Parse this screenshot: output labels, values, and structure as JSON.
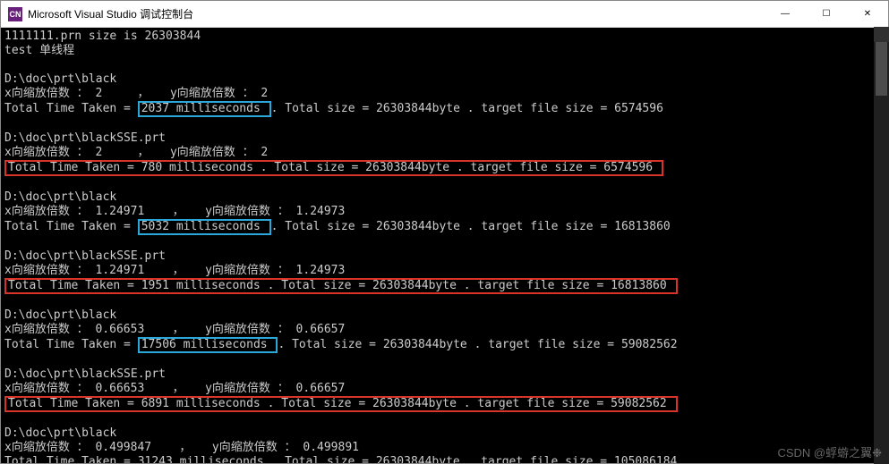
{
  "window": {
    "icon_label": "CN",
    "title": "Microsoft Visual Studio 调试控制台",
    "minimize": "—",
    "maximize": "☐",
    "close": "✕"
  },
  "console": {
    "intro": {
      "line1": "1111111.prn size is 26303844",
      "line2": "test 单线程"
    },
    "blocks": [
      {
        "path": "D:\\doc\\prt\\black",
        "scale_x_label": "x向缩放倍数 ：",
        "scale_x": " 2     ，   ",
        "scale_y_label": "y向缩放倍数 ：",
        "scale_y": " 2",
        "time_prefix": "Total Time Taken = ",
        "time_value": "2037 milliseconds ",
        "rest": ". Total size = 26303844byte . target file size = 6574596",
        "highlight": "blue"
      },
      {
        "path": "D:\\doc\\prt\\blackSSE.prt",
        "scale_x_label": "x向缩放倍数 ：",
        "scale_x": " 2     ，   ",
        "scale_y_label": "y向缩放倍数 ：",
        "scale_y": " 2",
        "full_line": "Total Time Taken = 780 milliseconds . Total size = 26303844byte . target file size = 6574596 ",
        "highlight": "red"
      },
      {
        "path": "D:\\doc\\prt\\black",
        "scale_x_label": "x向缩放倍数 ：",
        "scale_x": " 1.24971    ，   ",
        "scale_y_label": "y向缩放倍数 ：",
        "scale_y": " 1.24973",
        "time_prefix": "Total Time Taken = ",
        "time_value": "5032 milliseconds ",
        "rest": ". Total size = 26303844byte . target file size = 16813860",
        "highlight": "blue"
      },
      {
        "path": "D:\\doc\\prt\\blackSSE.prt",
        "scale_x_label": "x向缩放倍数 ：",
        "scale_x": " 1.24971    ，   ",
        "scale_y_label": "y向缩放倍数 ：",
        "scale_y": " 1.24973",
        "full_line": "Total Time Taken = 1951 milliseconds . Total size = 26303844byte . target file size = 16813860 ",
        "highlight": "red"
      },
      {
        "path": "D:\\doc\\prt\\black",
        "scale_x_label": "x向缩放倍数 ：",
        "scale_x": " 0.66653    ，   ",
        "scale_y_label": "y向缩放倍数 ：",
        "scale_y": " 0.66657",
        "time_prefix": "Total Time Taken = ",
        "time_value": "17506 milliseconds ",
        "rest": ". Total size = 26303844byte . target file size = 59082562",
        "highlight": "blue"
      },
      {
        "path": "D:\\doc\\prt\\blackSSE.prt",
        "scale_x_label": "x向缩放倍数 ：",
        "scale_x": " 0.66653    ，   ",
        "scale_y_label": "y向缩放倍数 ：",
        "scale_y": " 0.66657",
        "full_line": "Total Time Taken = 6891 milliseconds . Total size = 26303844byte . target file size = 59082562 ",
        "highlight": "red"
      },
      {
        "path": "D:\\doc\\prt\\black",
        "scale_x_label": "x向缩放倍数 ：",
        "scale_x": " 0.499847    ，   ",
        "scale_y_label": "y向缩放倍数 ：",
        "scale_y": " 0.499891",
        "time_prefix": "Total Time Taken = 31243 milliseconds . Total size = 26303844byte . target file size = 105086184",
        "time_value": "",
        "rest": "",
        "highlight": "none"
      }
    ]
  },
  "watermark": "CSDN @蜉蝣之翼❉"
}
